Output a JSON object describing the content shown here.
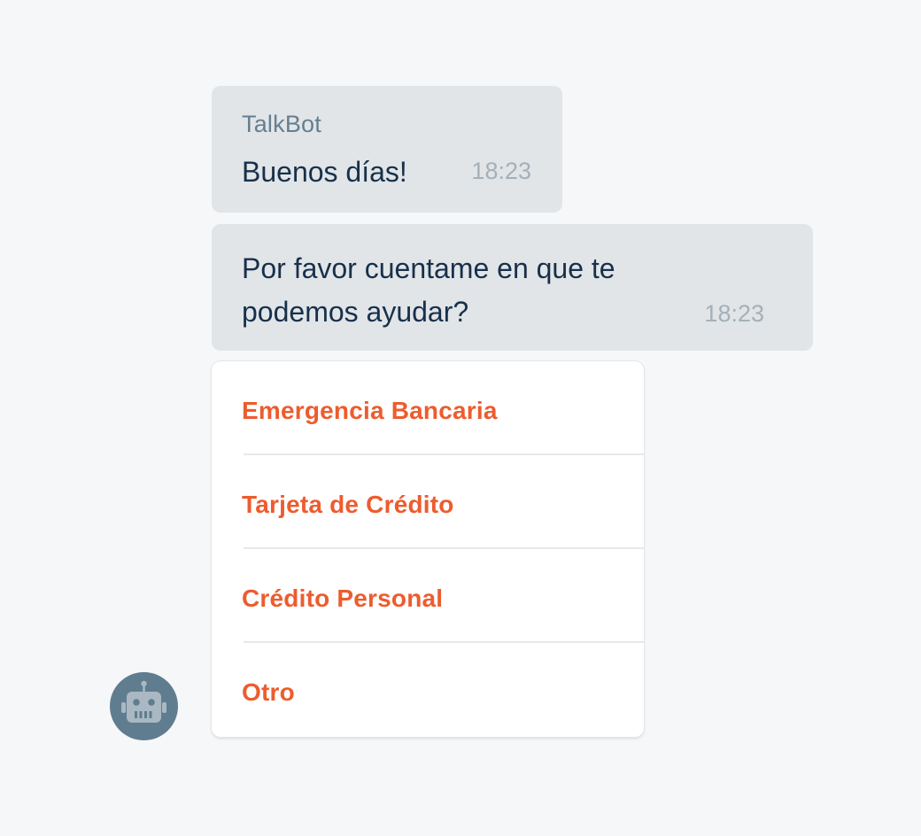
{
  "chat": {
    "messages": [
      {
        "sender": "TalkBot",
        "text": "Buenos días!",
        "time": "18:23"
      },
      {
        "text": "Por favor cuentame en que te podemos ayudar?",
        "time": "18:23"
      }
    ],
    "options": [
      {
        "label": "Emergencia Bancaria"
      },
      {
        "label": "Tarjeta de Crédito"
      },
      {
        "label": "Crédito Personal"
      },
      {
        "label": "Otro"
      }
    ],
    "avatar": {
      "icon": "robot-icon",
      "color": "#607d8f"
    }
  },
  "colors": {
    "background": "#f5f7f9",
    "bubble": "#e1e5e8",
    "option_text": "#ed5c2e",
    "sender_text": "#667e8f",
    "message_text": "#18304a",
    "time_text": "#a5b0b8"
  }
}
